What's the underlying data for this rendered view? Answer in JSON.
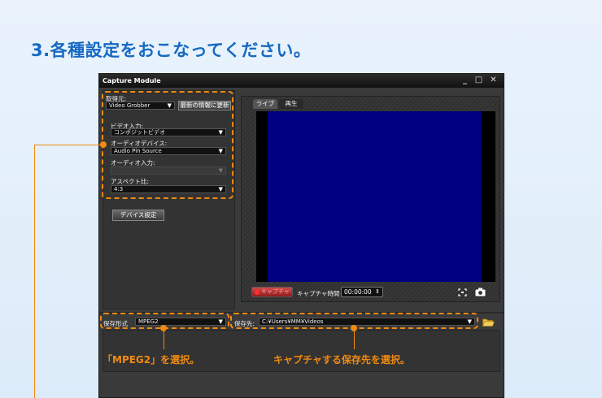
{
  "heading": "3.各種設定をおこなってください。",
  "window": {
    "title": "Capture Module",
    "minimize": "_",
    "maximize": "□",
    "close": "✕"
  },
  "source": {
    "label": "取得元:",
    "value": "Video Grobber",
    "refresh_button": "最新の情報に更新"
  },
  "video_input": {
    "label": "ビデオ入力:",
    "value": "コンポジットビデオ"
  },
  "audio_device": {
    "label": "オーディオデバイス:",
    "value": "Audio Pin Source"
  },
  "audio_input": {
    "label": "オーディオ入力:",
    "value": ""
  },
  "aspect": {
    "label": "アスペクト比:",
    "value": "4:3"
  },
  "device_settings_button": "デバイス設定",
  "tabs": [
    "ライブ",
    "再生"
  ],
  "capture": {
    "button": "キャプチャ",
    "time_label": "キャプチャ時間",
    "time_value": "00:00:00"
  },
  "save_format": {
    "label": "保存形式",
    "value": "MPEG2"
  },
  "save_dest": {
    "label": "保存先:",
    "value": "C:¥Users¥MM¥Videos"
  },
  "callouts": {
    "format": "「MPEG2」を選択。",
    "dest": "キャプチャする保存先を選択。"
  },
  "colors": {
    "accent": "#f08a10",
    "heading": "#1669c2",
    "preview": "#000080"
  },
  "icons": [
    "snapshot-frame-icon",
    "camera-icon",
    "folder-icon",
    "chevron-down-icon"
  ]
}
